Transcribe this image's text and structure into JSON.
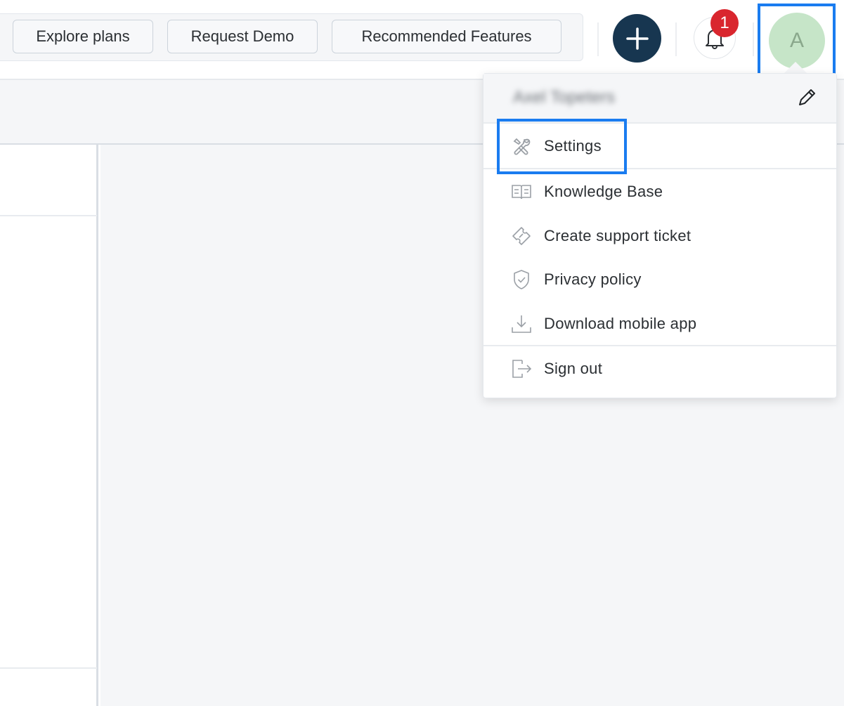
{
  "topbar": {
    "promo_buttons": [
      {
        "label": "Explore plans"
      },
      {
        "label": "Request Demo"
      },
      {
        "label": "Recommended Features"
      }
    ],
    "add_button": {
      "icon": "plus-icon"
    },
    "notifications": {
      "icon": "bell-icon",
      "badge_count": "1",
      "badge_color": "#d9262e"
    },
    "avatar": {
      "initial": "A",
      "background": "#c6e5c8"
    }
  },
  "user_menu": {
    "user_name": "Axel Topeters",
    "edit_icon": "pencil-icon",
    "items": [
      {
        "label": "Settings",
        "icon": "tools-icon"
      },
      {
        "label": "Knowledge Base",
        "icon": "book-icon"
      },
      {
        "label": "Create support ticket",
        "icon": "ticket-icon"
      },
      {
        "label": "Privacy policy",
        "icon": "shield-check-icon"
      },
      {
        "label": "Download mobile app",
        "icon": "download-icon"
      },
      {
        "label": "Sign out",
        "icon": "sign-out-icon"
      }
    ]
  },
  "colors": {
    "accent_highlight": "#1a7cf0",
    "add_button": "#173650",
    "panel_background": "#f5f6f8"
  }
}
